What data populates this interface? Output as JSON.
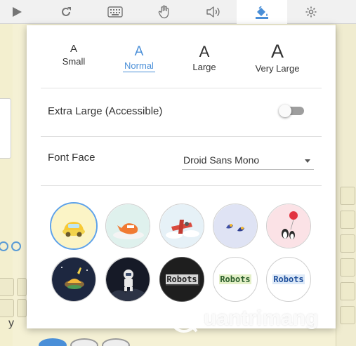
{
  "toolbar": {
    "buttons": [
      {
        "name": "play",
        "icon": "play-icon"
      },
      {
        "name": "reset",
        "icon": "rotate-icon"
      },
      {
        "name": "keyboard",
        "icon": "keyboard-icon"
      },
      {
        "name": "hand",
        "icon": "hand-icon"
      },
      {
        "name": "sound",
        "icon": "speaker-icon"
      },
      {
        "name": "theme",
        "icon": "paint-bucket-icon",
        "active": true
      },
      {
        "name": "settings",
        "icon": "gear-icon"
      }
    ]
  },
  "background": {
    "letter": "y"
  },
  "popup": {
    "font_sizes": [
      {
        "glyph": "A",
        "label": "Small"
      },
      {
        "glyph": "A",
        "label": "Normal",
        "selected": true
      },
      {
        "glyph": "A",
        "label": "Large"
      },
      {
        "glyph": "A",
        "label": "Very Large"
      }
    ],
    "extra_large": {
      "label": "Extra Large (Accessible)",
      "enabled": false
    },
    "font_face": {
      "label": "Font Face",
      "value": "Droid Sans Mono"
    },
    "themes": [
      {
        "name": "yellow-car",
        "selected": true
      },
      {
        "name": "fox"
      },
      {
        "name": "red-plane"
      },
      {
        "name": "birds"
      },
      {
        "name": "penguins-balloon"
      },
      {
        "name": "space-ship"
      },
      {
        "name": "astronaut"
      },
      {
        "name": "robots-dark",
        "text": "Robots"
      },
      {
        "name": "robots-green",
        "text": "Robots"
      },
      {
        "name": "robots-blue",
        "text": "Robots"
      }
    ]
  },
  "watermark": {
    "text": "uantrimang"
  },
  "colors": {
    "accent": "#4a8fd8",
    "background": "#f5f1d5",
    "toolbar": "#f1f1f1"
  }
}
